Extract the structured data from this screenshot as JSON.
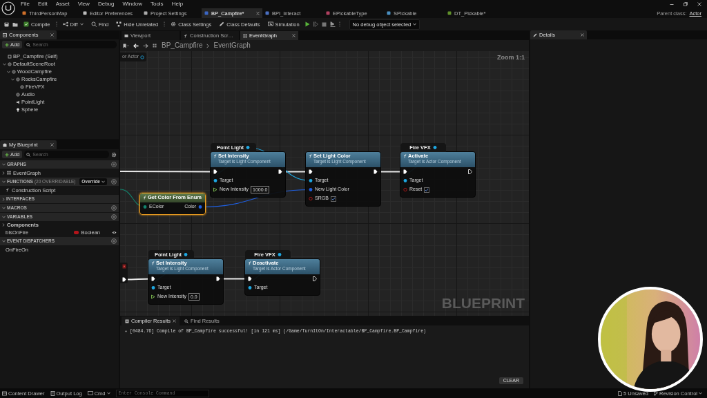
{
  "menu": [
    "File",
    "Edit",
    "Asset",
    "View",
    "Debug",
    "Window",
    "Tools",
    "Help"
  ],
  "asset_tabs": [
    {
      "label": "ThirdPersonMap",
      "selected": false
    },
    {
      "label": "Editor Preferences",
      "selected": false
    },
    {
      "label": "Project Settings",
      "selected": false
    },
    {
      "label": "BP_Campfire*",
      "selected": true
    },
    {
      "label": "BPI_Interact",
      "selected": false
    },
    {
      "label": "EPickableType",
      "selected": false
    },
    {
      "label": "SPickable",
      "selected": false
    },
    {
      "label": "DT_Pickable*",
      "selected": false
    }
  ],
  "parent_class": {
    "label": "Parent class:",
    "value": "Actor"
  },
  "toolbar": [
    {
      "label": "Compile",
      "dropdown": false
    },
    {
      "label": "Diff",
      "dropdown": true
    },
    {
      "label": "Find",
      "dropdown": false
    },
    {
      "label": "Hide Unrelated",
      "dropdown": false
    },
    {
      "label": "Class Settings",
      "dropdown": false
    },
    {
      "label": "Class Defaults",
      "dropdown": false
    },
    {
      "label": "Simulation",
      "dropdown": false
    }
  ],
  "debug_object": "No debug object selected",
  "components": {
    "title": "Components",
    "add": "Add",
    "search_placeholder": "Search",
    "tree": [
      {
        "label": "BP_Campfire (Self)"
      },
      {
        "label": "DefaultSceneRoot",
        "expanded": true,
        "children": [
          {
            "label": "WoodCampfire",
            "expanded": true,
            "children": [
              {
                "label": "RocksCampfire",
                "expanded": true,
                "children": [
                  {
                    "label": "FireVFX"
                  }
                ]
              },
              {
                "label": "Audio"
              },
              {
                "label": "PointLight"
              },
              {
                "label": "Sphere"
              }
            ]
          }
        ]
      }
    ]
  },
  "my_blueprint": {
    "title": "My Blueprint",
    "add": "Add",
    "search_placeholder": "Search",
    "sections": [
      {
        "title": "GRAPHS",
        "expanded": true,
        "add_button": true,
        "items": [
          {
            "kind": "graph",
            "label": "EventGraph"
          }
        ]
      },
      {
        "title": "FUNCTIONS",
        "note": "(20 OVERRIDABLE)",
        "button": "Override",
        "expanded": true,
        "add_button": true,
        "items": [
          {
            "kind": "function",
            "label": "Construction Script"
          }
        ]
      },
      {
        "title": "INTERFACES",
        "expanded": false,
        "add_button": false
      },
      {
        "title": "MACROS",
        "expanded": true,
        "add_button": true
      },
      {
        "title": "VARIABLES",
        "expanded": true,
        "add_button": true,
        "items": [
          {
            "kind": "category",
            "label": "Components",
            "expanded": false
          },
          {
            "kind": "variable",
            "label": "bIsOnFire",
            "type": "Boolean",
            "color": "#b3141a"
          }
        ]
      },
      {
        "title": "EVENT DISPATCHERS",
        "expanded": true,
        "add_button": true,
        "items": [
          {
            "kind": "dispatcher",
            "label": "OnFireOn"
          }
        ]
      }
    ]
  },
  "editor_tabs": [
    {
      "label": "Viewport",
      "selected": false
    },
    {
      "label": "Construction Scr…",
      "selected": false
    },
    {
      "label": "EventGraph",
      "selected": true
    }
  ],
  "breadcrumb": [
    "BP_Campfire",
    "EventGraph"
  ],
  "graph": {
    "zoom": "Zoom 1:1",
    "watermark": "BLUEPRINT",
    "fragment": "or Actor",
    "nodes": [
      {
        "kind": "function",
        "title": "Set Intensity",
        "subtitle": "Target is Light Component",
        "getter": "Point Light",
        "selected": false,
        "exec_out_connected": true,
        "inputs": [
          {
            "label": "Target",
            "kind": "object"
          },
          {
            "label": "New Intensity",
            "kind": "float",
            "value": "1000.0"
          }
        ]
      },
      {
        "kind": "pure",
        "title": "Get Color From Enum",
        "selected": true,
        "inputs": [
          {
            "label": "EColor",
            "kind": "enum"
          }
        ],
        "outputs": [
          {
            "label": "Color",
            "kind": "struct"
          }
        ]
      },
      {
        "kind": "function",
        "title": "Set Light Color",
        "subtitle": "Target is Light Component",
        "selected": false,
        "exec_out_connected": true,
        "inputs": [
          {
            "label": "Target",
            "kind": "object"
          },
          {
            "label": "New Light Color",
            "kind": "struct"
          },
          {
            "label": "SRGB",
            "kind": "bool",
            "checked": true
          }
        ]
      },
      {
        "kind": "function",
        "title": "Activate",
        "subtitle": "Target is Actor Component",
        "getter": "Fire VFX",
        "selected": false,
        "exec_out_connected": false,
        "inputs": [
          {
            "label": "Target",
            "kind": "object"
          },
          {
            "label": "Reset",
            "kind": "bool",
            "checked": true
          }
        ]
      },
      {
        "kind": "function",
        "title": "Set Intensity",
        "subtitle": "Target is Light Component",
        "getter": "Point Light",
        "selected": false,
        "exec_out_connected": true,
        "inputs": [
          {
            "label": "Target",
            "kind": "object"
          },
          {
            "label": "New Intensity",
            "kind": "float",
            "value": "0.0"
          }
        ]
      },
      {
        "kind": "function",
        "title": "Deactivate",
        "subtitle": "Target is Actor Component",
        "getter": "Fire VFX",
        "selected": false,
        "exec_out_connected": false,
        "inputs": [
          {
            "label": "Target",
            "kind": "object"
          }
        ]
      }
    ]
  },
  "results": {
    "tabs": [
      {
        "label": "Compiler Results",
        "selected": true
      },
      {
        "label": "Find Results",
        "selected": false
      }
    ],
    "messages": [
      "[0484.76] Compile of BP_Campfire successful! [in 121 ms] (/Game/TurnItOn/Interactable/BP_Campfire.BP_Campfire)"
    ],
    "clear": "CLEAR"
  },
  "details": {
    "title": "Details"
  },
  "status_bar": {
    "items": [
      "Content Drawer",
      "Output Log"
    ],
    "cmd": "Cmd",
    "console_placeholder": "Enter Console Command",
    "unsaved": "5 Unsaved",
    "revision_control": "Revision Control"
  },
  "webcam": {
    "kind": "picture"
  }
}
